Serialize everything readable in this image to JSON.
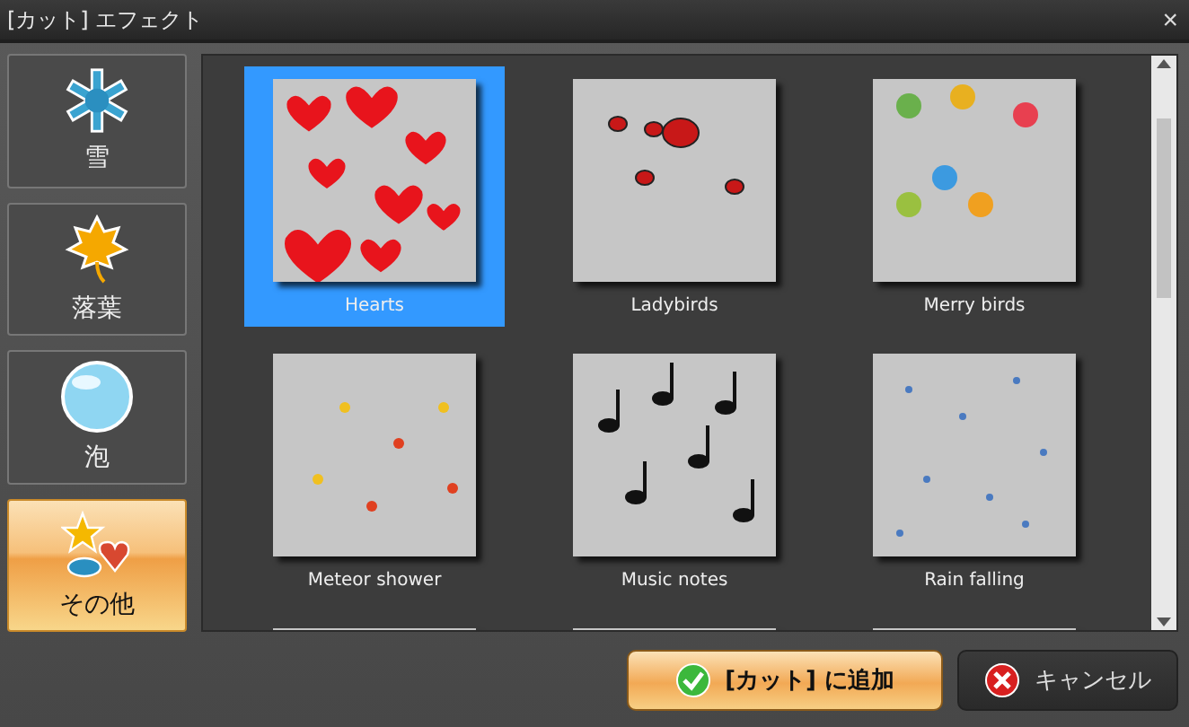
{
  "window": {
    "title": "[カット] エフェクト",
    "close": "×"
  },
  "categories": [
    {
      "label": "雪",
      "selected": false
    },
    {
      "label": "落葉",
      "selected": false
    },
    {
      "label": "泡",
      "selected": false
    },
    {
      "label": "その他",
      "selected": true
    }
  ],
  "effects": [
    {
      "label": "Hearts",
      "selected": true
    },
    {
      "label": "Ladybirds",
      "selected": false
    },
    {
      "label": "Merry birds",
      "selected": false
    },
    {
      "label": "Meteor shower",
      "selected": false
    },
    {
      "label": "Music notes",
      "selected": false
    },
    {
      "label": "Rain falling",
      "selected": false
    },
    {
      "selected": false
    },
    {
      "selected": false
    },
    {
      "selected": false
    }
  ],
  "buttons": [
    {
      "label": "[カット] に追加",
      "kind": "ok"
    },
    {
      "label": "キャンセル",
      "kind": "cancel"
    }
  ]
}
